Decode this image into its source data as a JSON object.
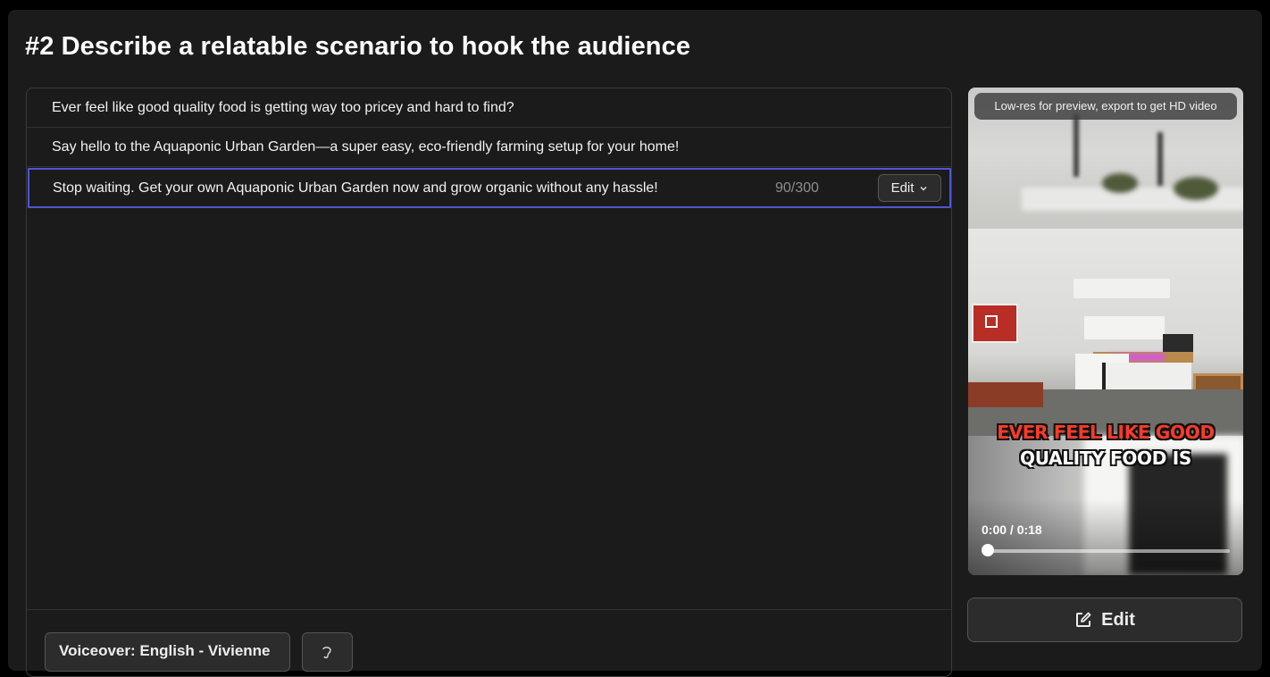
{
  "section_title": "#2 Describe a relatable scenario to hook the audience",
  "script_lines": [
    {
      "text": "Ever feel like good quality food is getting way too pricey and hard to find?"
    },
    {
      "text": "Say hello to the Aquaponic Urban Garden—a super easy, eco-friendly farming setup for your home!"
    },
    {
      "text": "Stop waiting. Get your own Aquaponic Urban Garden now and grow organic without any hassle!",
      "char_count": "90/300",
      "edit_label": "Edit",
      "selected": true
    }
  ],
  "footer": {
    "voiceover_label": "Voiceover: English - Vivienne"
  },
  "preview": {
    "banner": "Low-res for preview, export to get HD video",
    "caption_line1": "EVER FEEL LIKE GOOD",
    "caption_line2": "QUALITY FOOD IS",
    "time": "0:00 / 0:18",
    "progress": 0,
    "edit_label": "Edit"
  },
  "colors": {
    "selection_border": "#4f56d6",
    "caption_highlight": "#ff3a2a",
    "background": "#1b1b1b"
  }
}
